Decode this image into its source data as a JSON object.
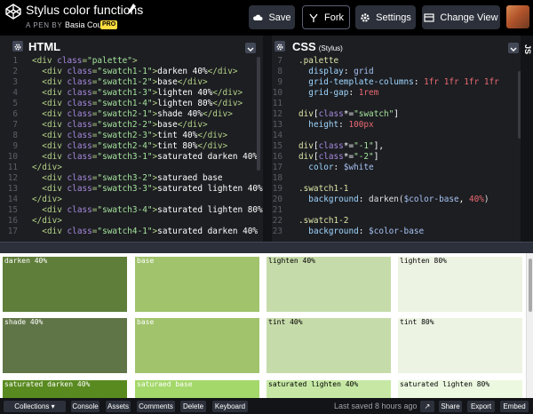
{
  "header": {
    "title": "Stylus color functions",
    "byline_prefix": "A PEN BY",
    "author": "Basia Coulter",
    "pro_badge": "PRO",
    "buttons": {
      "save": "Save",
      "fork": "Fork",
      "settings": "Settings",
      "change_view": "Change View"
    }
  },
  "html_pane": {
    "title": "HTML",
    "lines": [
      [
        [
          "t-tag",
          "<div "
        ],
        [
          "t-attr",
          "class"
        ],
        [
          "t-tag",
          "="
        ],
        [
          "t-str",
          "\"palette\""
        ],
        [
          "t-tag",
          ">"
        ]
      ],
      [
        [
          "t-txt",
          "  "
        ],
        [
          "t-tag",
          "<div "
        ],
        [
          "t-attr",
          "class"
        ],
        [
          "t-tag",
          "="
        ],
        [
          "t-str",
          "\"swatch1-1\""
        ],
        [
          "t-tag",
          ">"
        ],
        [
          "t-txt",
          "darken 40%"
        ],
        [
          "t-tag",
          "</div>"
        ]
      ],
      [
        [
          "t-txt",
          "  "
        ],
        [
          "t-tag",
          "<div "
        ],
        [
          "t-attr",
          "class"
        ],
        [
          "t-tag",
          "="
        ],
        [
          "t-str",
          "\"swatch1-2\""
        ],
        [
          "t-tag",
          ">"
        ],
        [
          "t-txt",
          "base"
        ],
        [
          "t-tag",
          "</div>"
        ]
      ],
      [
        [
          "t-txt",
          "  "
        ],
        [
          "t-tag",
          "<div "
        ],
        [
          "t-attr",
          "class"
        ],
        [
          "t-tag",
          "="
        ],
        [
          "t-str",
          "\"swatch1-3\""
        ],
        [
          "t-tag",
          ">"
        ],
        [
          "t-txt",
          "lighten 40%"
        ],
        [
          "t-tag",
          "</div>"
        ]
      ],
      [
        [
          "t-txt",
          "  "
        ],
        [
          "t-tag",
          "<div "
        ],
        [
          "t-attr",
          "class"
        ],
        [
          "t-tag",
          "="
        ],
        [
          "t-str",
          "\"swatch1-4\""
        ],
        [
          "t-tag",
          ">"
        ],
        [
          "t-txt",
          "lighten 80%"
        ],
        [
          "t-tag",
          "</div>"
        ]
      ],
      [
        [
          "t-txt",
          "  "
        ],
        [
          "t-tag",
          "<div "
        ],
        [
          "t-attr",
          "class"
        ],
        [
          "t-tag",
          "="
        ],
        [
          "t-str",
          "\"swatch2-1\""
        ],
        [
          "t-tag",
          ">"
        ],
        [
          "t-txt",
          "shade 40%"
        ],
        [
          "t-tag",
          "</div>"
        ]
      ],
      [
        [
          "t-txt",
          "  "
        ],
        [
          "t-tag",
          "<div "
        ],
        [
          "t-attr",
          "class"
        ],
        [
          "t-tag",
          "="
        ],
        [
          "t-str",
          "\"swatch2-2\""
        ],
        [
          "t-tag",
          ">"
        ],
        [
          "t-txt",
          "base"
        ],
        [
          "t-tag",
          "</div>"
        ]
      ],
      [
        [
          "t-txt",
          "  "
        ],
        [
          "t-tag",
          "<div "
        ],
        [
          "t-attr",
          "class"
        ],
        [
          "t-tag",
          "="
        ],
        [
          "t-str",
          "\"swatch2-3\""
        ],
        [
          "t-tag",
          ">"
        ],
        [
          "t-txt",
          "tint 40%"
        ],
        [
          "t-tag",
          "</div>"
        ]
      ],
      [
        [
          "t-txt",
          "  "
        ],
        [
          "t-tag",
          "<div "
        ],
        [
          "t-attr",
          "class"
        ],
        [
          "t-tag",
          "="
        ],
        [
          "t-str",
          "\"swatch2-4\""
        ],
        [
          "t-tag",
          ">"
        ],
        [
          "t-txt",
          "tint 80%"
        ],
        [
          "t-tag",
          "</div>"
        ]
      ],
      [
        [
          "t-txt",
          "  "
        ],
        [
          "t-tag",
          "<div "
        ],
        [
          "t-attr",
          "class"
        ],
        [
          "t-tag",
          "="
        ],
        [
          "t-str",
          "\"swatch3-1\""
        ],
        [
          "t-tag",
          ">"
        ],
        [
          "t-txt",
          "saturated darken 40%"
        ]
      ],
      [
        [
          "t-tag",
          "</div>"
        ]
      ],
      [
        [
          "t-txt",
          "  "
        ],
        [
          "t-tag",
          "<div "
        ],
        [
          "t-attr",
          "class"
        ],
        [
          "t-tag",
          "="
        ],
        [
          "t-str",
          "\"swatch3-2\""
        ],
        [
          "t-tag",
          ">"
        ],
        [
          "t-txt",
          "saturaed base"
        ]
      ],
      [
        [
          "t-txt",
          "  "
        ],
        [
          "t-tag",
          "<div "
        ],
        [
          "t-attr",
          "class"
        ],
        [
          "t-tag",
          "="
        ],
        [
          "t-str",
          "\"swatch3-3\""
        ],
        [
          "t-tag",
          ">"
        ],
        [
          "t-txt",
          "saturated lighten 40%"
        ]
      ],
      [
        [
          "t-tag",
          "</div>"
        ]
      ],
      [
        [
          "t-txt",
          "  "
        ],
        [
          "t-tag",
          "<div "
        ],
        [
          "t-attr",
          "class"
        ],
        [
          "t-tag",
          "="
        ],
        [
          "t-str",
          "\"swatch3-4\""
        ],
        [
          "t-tag",
          ">"
        ],
        [
          "t-txt",
          "saturated lighten 80%"
        ]
      ],
      [
        [
          "t-tag",
          "</div>"
        ]
      ],
      [
        [
          "t-txt",
          "  "
        ],
        [
          "t-tag",
          "<div "
        ],
        [
          "t-attr",
          "class"
        ],
        [
          "t-tag",
          "="
        ],
        [
          "t-str",
          "\"swatch4-1\""
        ],
        [
          "t-tag",
          ">"
        ],
        [
          "t-txt",
          "saturated darken 40%"
        ]
      ]
    ]
  },
  "css_pane": {
    "title": "CSS",
    "subtitle": "(Stylus)",
    "first_line_number": 7,
    "lines": [
      [
        [
          "t-sel",
          ".palette"
        ]
      ],
      [
        [
          "t-txt",
          "  "
        ],
        [
          "t-prop",
          "display"
        ],
        [
          "t-txt",
          ": "
        ],
        [
          "t-val",
          "grid"
        ]
      ],
      [
        [
          "t-txt",
          "  "
        ],
        [
          "t-prop",
          "grid-template-columns"
        ],
        [
          "t-txt",
          ": "
        ],
        [
          "t-num",
          "1fr 1fr 1fr 1fr"
        ]
      ],
      [
        [
          "t-txt",
          "  "
        ],
        [
          "t-prop",
          "grid-gap"
        ],
        [
          "t-txt",
          ": "
        ],
        [
          "t-num",
          "1rem"
        ]
      ],
      [],
      [
        [
          "t-sel",
          "div"
        ],
        [
          "t-txt",
          "["
        ],
        [
          "t-attr",
          "class"
        ],
        [
          "t-txt",
          "*="
        ],
        [
          "t-str",
          "\"swatch\""
        ],
        [
          "t-txt",
          "]"
        ]
      ],
      [
        [
          "t-txt",
          "  "
        ],
        [
          "t-prop",
          "height"
        ],
        [
          "t-txt",
          ": "
        ],
        [
          "t-num",
          "100px"
        ]
      ],
      [],
      [
        [
          "t-sel",
          "div"
        ],
        [
          "t-txt",
          "["
        ],
        [
          "t-attr",
          "class"
        ],
        [
          "t-txt",
          "*="
        ],
        [
          "t-str",
          "\"-1\""
        ],
        [
          "t-txt",
          "],"
        ]
      ],
      [
        [
          "t-sel",
          "div"
        ],
        [
          "t-txt",
          "["
        ],
        [
          "t-attr",
          "class"
        ],
        [
          "t-txt",
          "*="
        ],
        [
          "t-str",
          "\"-2\""
        ],
        [
          "t-txt",
          "]"
        ]
      ],
      [
        [
          "t-txt",
          "  "
        ],
        [
          "t-prop",
          "color"
        ],
        [
          "t-txt",
          ": "
        ],
        [
          "t-val",
          "$white"
        ]
      ],
      [],
      [
        [
          "t-sel",
          ".swatch1-1"
        ]
      ],
      [
        [
          "t-txt",
          "  "
        ],
        [
          "t-prop",
          "background"
        ],
        [
          "t-txt",
          ": "
        ],
        [
          "t-fn",
          "darken("
        ],
        [
          "t-val",
          "$color-base"
        ],
        [
          "t-txt",
          ", "
        ],
        [
          "t-num",
          "40%"
        ],
        [
          "t-fn",
          ")"
        ]
      ],
      [],
      [
        [
          "t-sel",
          ".swatch1-2"
        ]
      ],
      [
        [
          "t-txt",
          "  "
        ],
        [
          "t-prop",
          "background"
        ],
        [
          "t-txt",
          ": "
        ],
        [
          "t-val",
          "$color-base"
        ]
      ]
    ]
  },
  "side_tab": "JS",
  "swatches": [
    {
      "label": "darken 40%",
      "bg": "#5f7e3a",
      "fg": "#ffffff"
    },
    {
      "label": "base",
      "bg": "#a0c36c",
      "fg": "#ffffff"
    },
    {
      "label": "lighten 40%",
      "bg": "#c6dbaa",
      "fg": "#000000"
    },
    {
      "label": "lighten 80%",
      "bg": "#ecf3e2",
      "fg": "#000000"
    },
    {
      "label": "shade 40%",
      "bg": "#607547",
      "fg": "#ffffff"
    },
    {
      "label": "base",
      "bg": "#a0c36c",
      "fg": "#ffffff"
    },
    {
      "label": "tint 40%",
      "bg": "#c6dbaa",
      "fg": "#000000"
    },
    {
      "label": "tint 80%",
      "bg": "#ecf3e2",
      "fg": "#000000"
    },
    {
      "label": "saturated darken 40%",
      "bg": "#598a20",
      "fg": "#ffffff"
    },
    {
      "label": "saturaed base",
      "bg": "#a4d86a",
      "fg": "#ffffff"
    },
    {
      "label": "saturated lighten 40%",
      "bg": "#c6e8a4",
      "fg": "#000000"
    },
    {
      "label": "saturated lighten 80%",
      "bg": "#ecf8e0",
      "fg": "#000000"
    }
  ],
  "footer": {
    "collections": "Collections",
    "buttons": [
      "Console",
      "Assets",
      "Comments",
      "Delete",
      "Keyboard"
    ],
    "saved": "Last saved 8 hours ago",
    "right_buttons": [
      "Share",
      "Export",
      "Embed"
    ]
  },
  "colors": {
    "header_bg": "#000000",
    "editor_bg": "#1d1e22",
    "tag": "#b4d388",
    "attr": "#a88adf",
    "string": "#a4e39c",
    "pro": "#ffdd40"
  }
}
